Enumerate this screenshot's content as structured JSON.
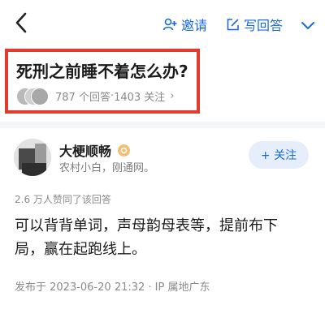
{
  "header": {
    "invite_label": "邀请",
    "write_answer_label": "写回答"
  },
  "question": {
    "title": "死刑之前睡不着怎么办?",
    "answers": "787 个回答",
    "separator": " · ",
    "followers": "1403 关注",
    "chevron": "›"
  },
  "author": {
    "name": "大梗顺畅",
    "bio": "农村小白，刚通网。",
    "follow_label": "+ 关注"
  },
  "answer": {
    "approvals": "2.6 万人赞同了该回答",
    "lines": [
      "可以背背单词，声母韵母表等，提前布下",
      "局，赢在起跑线上。"
    ],
    "published": "发布于 2023-06-20 21:32 · IP 属地广东"
  },
  "colors": {
    "accent": "#1769e0",
    "highlight_border": "#e33a30"
  },
  "icons": [
    "back-arrow-icon",
    "invite-person-icon",
    "edit-icon",
    "more-icon",
    "badge-icon"
  ]
}
